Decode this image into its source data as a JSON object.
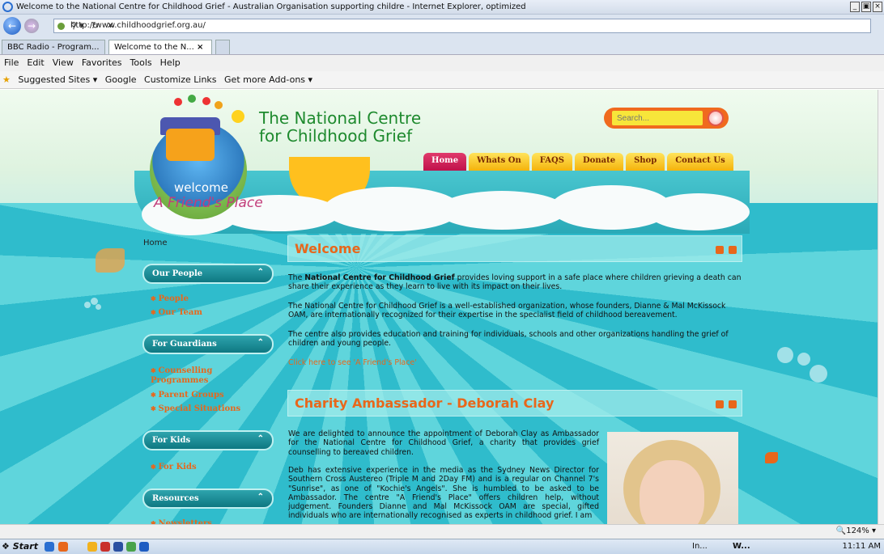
{
  "browser": {
    "title": "Welcome to the National Centre for Childhood Grief - Australian Organisation supporting childre - Internet Explorer, optimized",
    "url": "http://www.childhoodgrief.org.au/",
    "tabs": [
      {
        "label": "BBC Radio - Program..."
      },
      {
        "label": "Welcome to the N..."
      }
    ],
    "menu": [
      "File",
      "Edit",
      "View",
      "Favorites",
      "Tools",
      "Help"
    ],
    "favorites": [
      "Suggested Sites ▾",
      "Google",
      "Customize Links",
      "Get more Add-ons ▾"
    ],
    "zoom": "🔍124% ▾"
  },
  "site": {
    "title_line1": "The National Centre",
    "title_line2": "for Childhood Grief",
    "logo_welcome": "welcome",
    "logo_friends": "A Friend's Place",
    "search_placeholder": "Search...",
    "nav": [
      "Home",
      "Whats On",
      "FAQS",
      "Donate",
      "Shop",
      "Contact Us"
    ],
    "breadcrumb": "Home",
    "sidebar": [
      {
        "heading": "Our People",
        "links": [
          "People",
          "Our Team"
        ]
      },
      {
        "heading": "For Guardians",
        "links": [
          "Counselling Programmes",
          "Parent Groups",
          "Special Situations"
        ]
      },
      {
        "heading": "For Kids",
        "links": [
          "For Kids"
        ]
      },
      {
        "heading": "Resources",
        "links": [
          "Newsletters"
        ]
      }
    ],
    "welcome": {
      "heading": "Welcome",
      "p1_bold": "National Centre for Childhood Grief",
      "p1_pre": "The ",
      "p1_post": " provides loving support in a safe place where children grieving a death can share their experience as they learn to live with its impact on their lives.",
      "p2": "The National Centre for Childhood Grief is a well-established organization, whose founders, Dianne & Mal McKissock OAM, are internationally recognized for their expertise in the specialist field of childhood bereavement.",
      "p3": "The centre also provides education and training for individuals, schools and other organizations handling the grief of children and young people.",
      "link": "Click here to see 'A Friend's Place'"
    },
    "ambassador": {
      "heading": "Charity Ambassador - Deborah Clay",
      "p1": "We are delighted to announce the appointment of Deborah Clay as Ambassador for the National Centre for Childhood Grief, a charity that provides grief counselling to bereaved children.",
      "p2": "Deb has extensive experience in the media as the Sydney News Director for Southern Cross Austereo (Triple M and 2Day FM) and is a regular on Channel 7's \"Sunrise\", as one of \"Kochie's Angels\". She is humbled to be asked to be Ambassador. The centre \"A Friend's Place\" offers children help, without judgement. Founders Dianne and Mal McKissock OAM are special, gifted individuals who are internationally recognised as experts in childhood grief. I am"
    }
  },
  "taskbar": {
    "start": "Start",
    "items": [
      "In...",
      "W..."
    ],
    "clock": "11:11 AM"
  },
  "colors": {
    "accent": "#e8671b",
    "sea": "#3cc7d2",
    "nav_home": "#c0124b",
    "nav_tab": "#f4b30c"
  }
}
